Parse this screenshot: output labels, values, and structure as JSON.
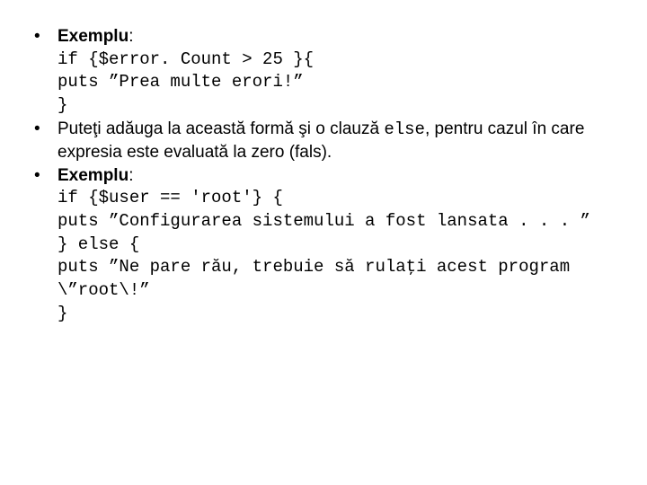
{
  "bullets": {
    "b1": {
      "label": "Exemplu",
      "colon": ":",
      "code": {
        "l1": "if {$error. Count > 25 }{",
        "l2": "puts ”Prea multe erori!”",
        "l3": "}"
      }
    },
    "b2": {
      "pre": "Puteţi adăuga la această formă şi o clauză ",
      "code_word": "else",
      "post": ", pentru cazul în care expresia este evaluată la zero (fals)."
    },
    "b3": {
      "label": "Exemplu",
      "colon": ":",
      "code": {
        "l1": "if {$user == 'root'} {",
        "l2": "puts ”Configurarea sistemului a fost lansata . . . ”",
        "l3": "} else {",
        "l4": "puts ”Ne pare rău, trebuie să rulaţi acest program \\”root\\!”",
        "l5": "}"
      }
    }
  }
}
